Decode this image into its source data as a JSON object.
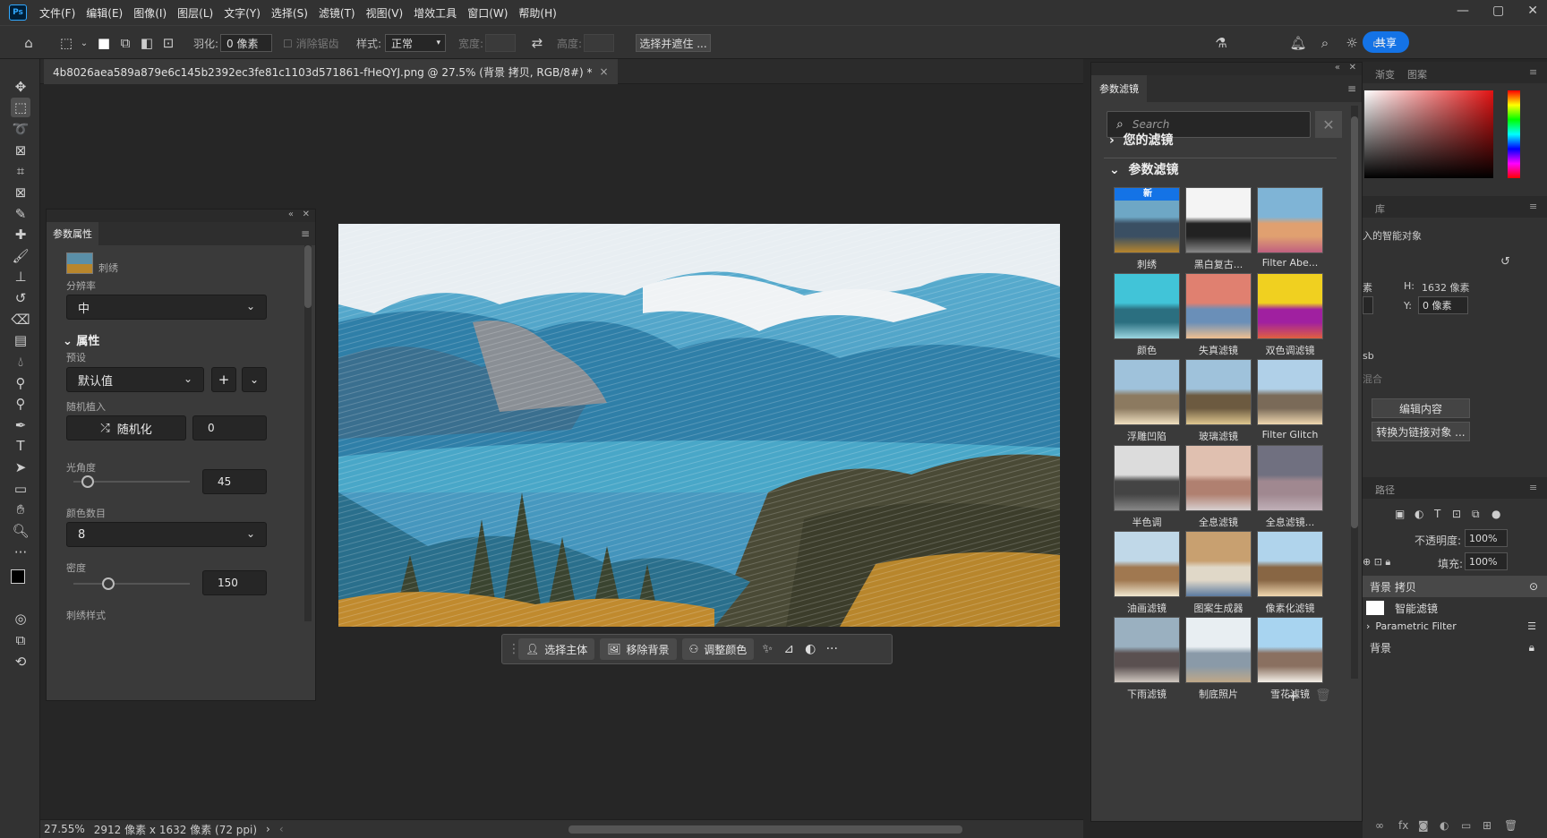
{
  "menu": {
    "logo": "Ps",
    "items": [
      "文件(F)",
      "编辑(E)",
      "图像(I)",
      "图层(L)",
      "文字(Y)",
      "选择(S)",
      "滤镜(T)",
      "视图(V)",
      "增效工具",
      "窗口(W)",
      "帮助(H)"
    ]
  },
  "options_bar": {
    "feather_label": "羽化:",
    "feather_value": "0 像素",
    "antialias_label": "消除锯齿",
    "style_label": "样式:",
    "style_value": "正常",
    "width_label": "宽度:",
    "height_label": "高度:",
    "select_mask_button": "选择并遮住 ...",
    "share_button": "共享"
  },
  "document": {
    "tab_title": "4b8026aea589a879e6c145b2392ec3fe81c1103d571861-fHeQYJ.png @ 27.5% (背景 拷贝, RGB/8#) *",
    "close": "×"
  },
  "context_bar": {
    "select_subject": "选择主体",
    "remove_background": "移除背景",
    "adjust_color": "调整颜色",
    "more": "···"
  },
  "status_bar": {
    "zoom": "27.55%",
    "dimensions": "2912 像素 x 1632 像素 (72 ppi)"
  },
  "properties_panel": {
    "tab": "参数属性",
    "filter_name": "刺绣",
    "resolution_label": "分辨率",
    "resolution_value": "中",
    "section_title": "属性",
    "preset_label": "预设",
    "preset_value": "默认值",
    "random_seed_label": "随机植入",
    "randomize_button": "随机化",
    "seed_value": "0",
    "light_angle_label": "光角度",
    "light_angle_value": "45",
    "light_angle_fraction": 0.12,
    "color_count_label": "颜色数目",
    "color_count_value": "8",
    "density_label": "密度",
    "density_value": "150",
    "density_fraction": 0.3,
    "stitch_style_label": "刺绣样式"
  },
  "neural_filters": {
    "tab": "参数滤镜",
    "search_placeholder": "Search",
    "your_filters": "您的滤镜",
    "param_filters": "参数滤镜",
    "new_badge": "新",
    "filters": [
      "刺绣",
      "黑白复古...",
      "Filter Abe...",
      "颜色",
      "失真滤镜",
      "双色调滤镜",
      "浮雕凹陷",
      "玻璃滤镜",
      "Filter Glitch",
      "半色调",
      "全息滤镜",
      "全息滤镜...",
      "油画滤镜",
      "图案生成器",
      "像素化滤镜",
      "下雨滤镜",
      "制底照片",
      "雪花滤镜"
    ],
    "add": "+"
  },
  "right_dock": {
    "tab_gradient": "渐变",
    "tab_pattern": "图案",
    "library_tab": "库",
    "embedded_smart_object": "入的智能对象",
    "h_label": "H:",
    "h_value": "1632 像素",
    "y_label": "Y:",
    "y_value": "0 像素",
    "px_label": "素",
    "rgb_label": "sb",
    "blend_label": "混合",
    "edit_content": "编辑内容",
    "convert_linked": "转换为链接对象 ...",
    "paths_tab": "路径",
    "opacity_label": "不透明度:",
    "opacity_value": "100%",
    "fill_label": "填充:",
    "fill_value": "100%",
    "layer_copy": "背景 拷贝",
    "smart_filter": "智能滤镜",
    "parametric_filter": "Parametric Filter",
    "layer_bg": "背景"
  },
  "colors": {
    "accent": "#1473e6",
    "panel": "#3a3a3a",
    "dark": "#262626"
  }
}
